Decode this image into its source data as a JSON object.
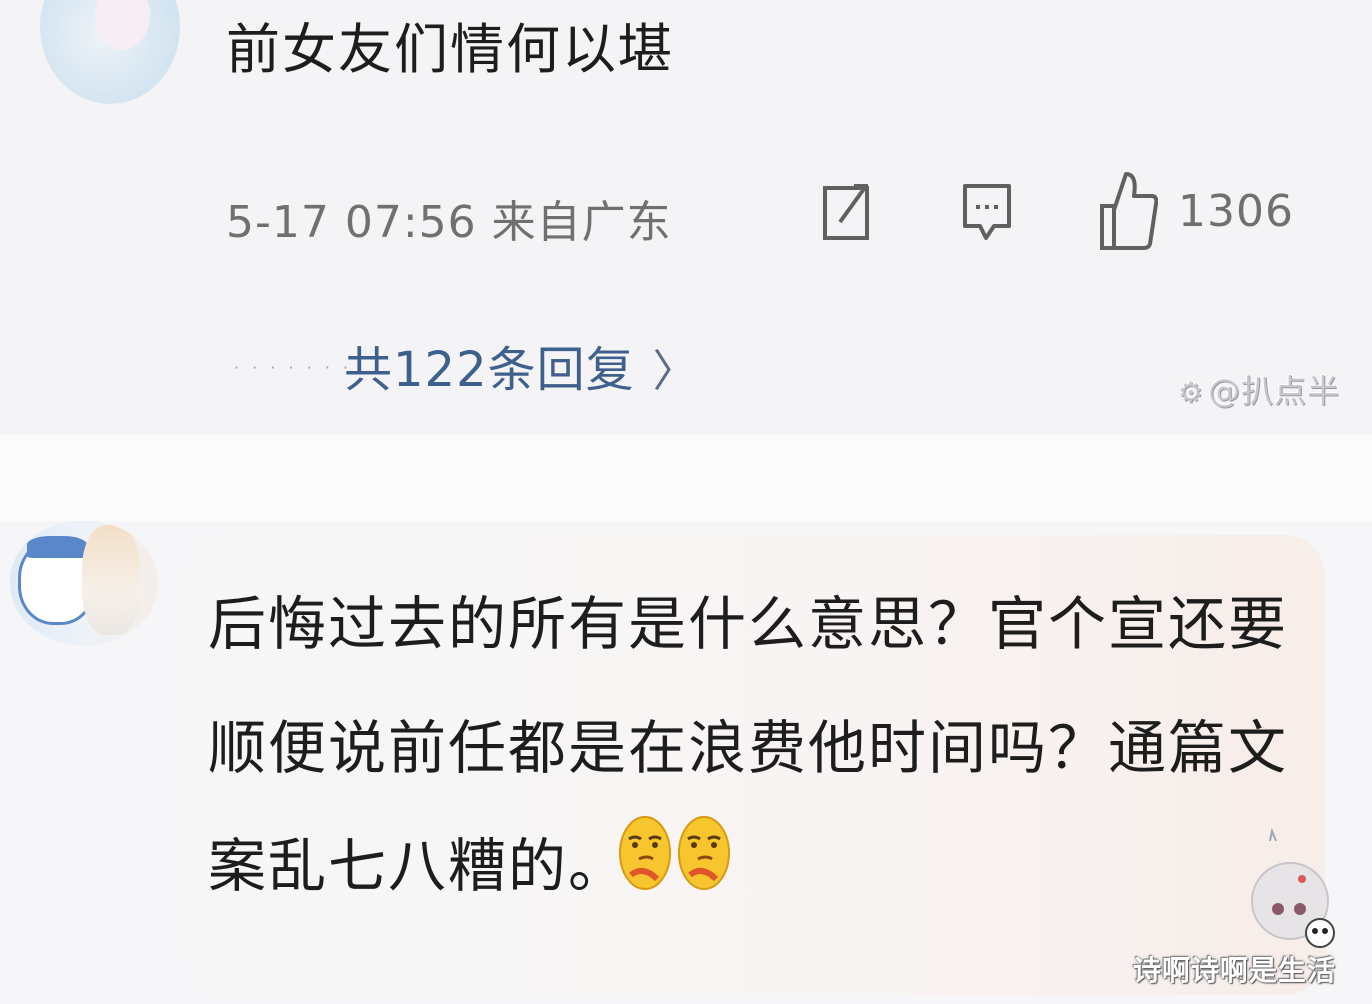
{
  "comments": [
    {
      "text": "前女友们情何以堪",
      "timestamp": "5-17 07:56 来自广东",
      "actions": {
        "share_icon": "share-icon",
        "reply_icon": "comment-icon",
        "like_icon": "thumbs-up-icon"
      },
      "like_count": "1306",
      "replies_label": "共122条回复",
      "replies_dots": "· · · · · · ·",
      "replies_chevron": "〉"
    },
    {
      "lines": [
        "后悔过去的所有是什么意思？官个宣还要",
        "顺便说前任都是在浪费他时间吗？通篇文",
        "案乱七八糟的。"
      ],
      "emojis": [
        "smirk-emoji",
        "smirk-emoji"
      ]
    }
  ],
  "watermarks": {
    "top": "@扒点半",
    "bottom": "诗啊诗啊是生活"
  },
  "colors": {
    "reply_link": "#3f5f8c",
    "meta_text": "#707070",
    "icon": "#606060"
  }
}
